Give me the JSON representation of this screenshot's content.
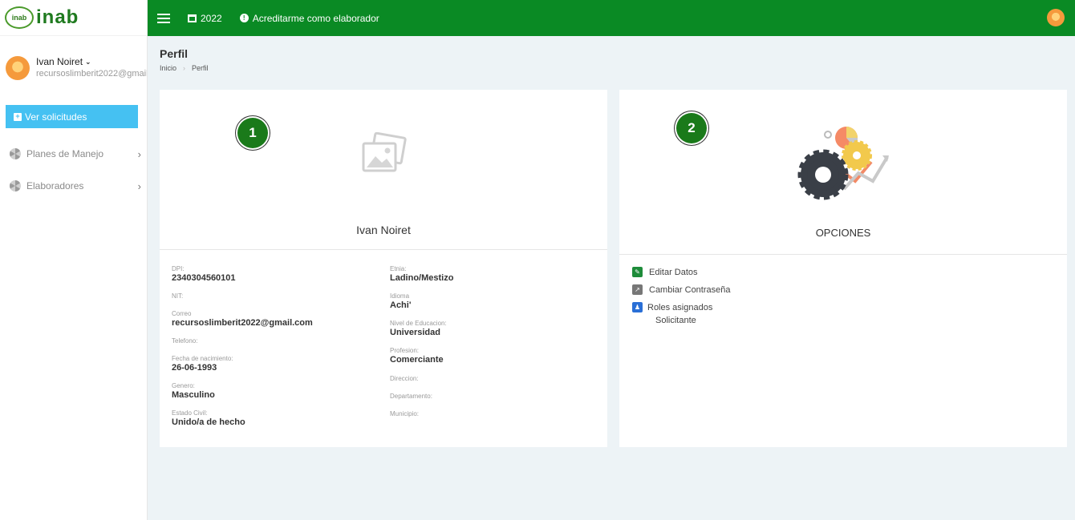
{
  "sidebar": {
    "logo_badge": "inab",
    "logo_text": "inab",
    "user_name": "Ivan Noiret",
    "user_email": "recursoslimberit2022@gmail.com",
    "ver_solicitudes": "Ver solicitudes",
    "items": [
      {
        "label": "Planes de Manejo"
      },
      {
        "label": "Elaboradores"
      }
    ]
  },
  "topbar": {
    "year": "2022",
    "acreditarme": "Acreditarme como elaborador"
  },
  "page": {
    "title": "Perfil",
    "breadcrumb": [
      "Inicio",
      "Perfil"
    ]
  },
  "profile_card": {
    "badge": "1",
    "name": "Ivan Noiret",
    "left_fields": [
      {
        "label": "DPI:",
        "value": "2340304560101"
      },
      {
        "label": "NIT:",
        "value": ""
      },
      {
        "label": "Correo",
        "value": "recursoslimberit2022@gmail.com"
      },
      {
        "label": "Telefono:",
        "value": ""
      },
      {
        "label": "Fecha de nacimiento:",
        "value": "26-06-1993"
      },
      {
        "label": "Genero:",
        "value": "Masculino"
      },
      {
        "label": "Estado Civil:",
        "value": "Unido/a de hecho"
      }
    ],
    "right_fields": [
      {
        "label": "Etnia:",
        "value": "Ladino/Mestizo"
      },
      {
        "label": "Idioma",
        "value": "Achi'"
      },
      {
        "label": "Nivel de Educacion:",
        "value": "Universidad"
      },
      {
        "label": "Profesion:",
        "value": "Comerciante"
      },
      {
        "label": "Direccion:",
        "value": ""
      },
      {
        "label": "Departamento:",
        "value": ""
      },
      {
        "label": "Municipio:",
        "value": ""
      }
    ]
  },
  "options_card": {
    "badge": "2",
    "title": "OPCIONES",
    "editar": "Editar Datos",
    "cambiar": "Cambiar Contraseña",
    "roles": "Roles asignados",
    "roles_value": "Solicitante"
  },
  "colors": {
    "topbar": "#0a8a24",
    "button": "#45c1f2",
    "badge": "#1a7a1a"
  }
}
